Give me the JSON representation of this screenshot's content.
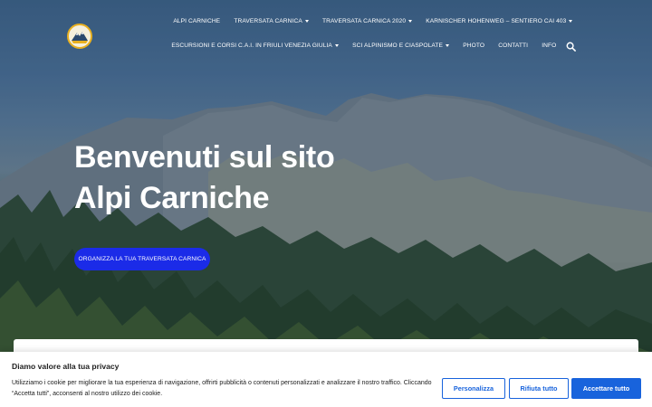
{
  "header": {
    "logo_name": "alpi-carniche-logo",
    "nav_row1": [
      {
        "label": "ALPI CARNICHE",
        "dropdown": false
      },
      {
        "label": "TRAVERSATA CARNICA",
        "dropdown": true
      },
      {
        "label": "TRAVERSATA CARNICA 2020",
        "dropdown": true
      },
      {
        "label": "KARNISCHER HOHENWEG – SENTIERO CAI 403",
        "dropdown": true
      }
    ],
    "nav_row2": [
      {
        "label": "ESCURSIONI E CORSI C.A.I. IN FRIULI VENEZIA GIULIA",
        "dropdown": true
      },
      {
        "label": "SCI ALPINISMO E CIASPOLATE",
        "dropdown": true
      },
      {
        "label": "PHOTO",
        "dropdown": false
      },
      {
        "label": "CONTATTI",
        "dropdown": false
      },
      {
        "label": "INFO",
        "dropdown": false
      }
    ],
    "search_icon": "search-icon"
  },
  "hero": {
    "title_line1": "Benvenuti sul sito",
    "title_line2": "Alpi Carniche",
    "cta_label": "ORGANIZZA LA TUA TRAVERSATA CARNICA"
  },
  "cookie_banner": {
    "title": "Diamo valore alla tua privacy",
    "text": "Utilizziamo i cookie per migliorare la tua esperienza di navigazione, offrirti pubblicità o contenuti personalizzati e analizzare il nostro traffico. Cliccando “Accetta tutti”, acconsenti al nostro utilizzo dei cookie.",
    "customize_label": "Personalizza",
    "reject_label": "Rifiuta tutto",
    "accept_label": "Accettare tutto"
  },
  "colors": {
    "cta": "#1b2be8",
    "cookie_accent": "#1863dc"
  }
}
